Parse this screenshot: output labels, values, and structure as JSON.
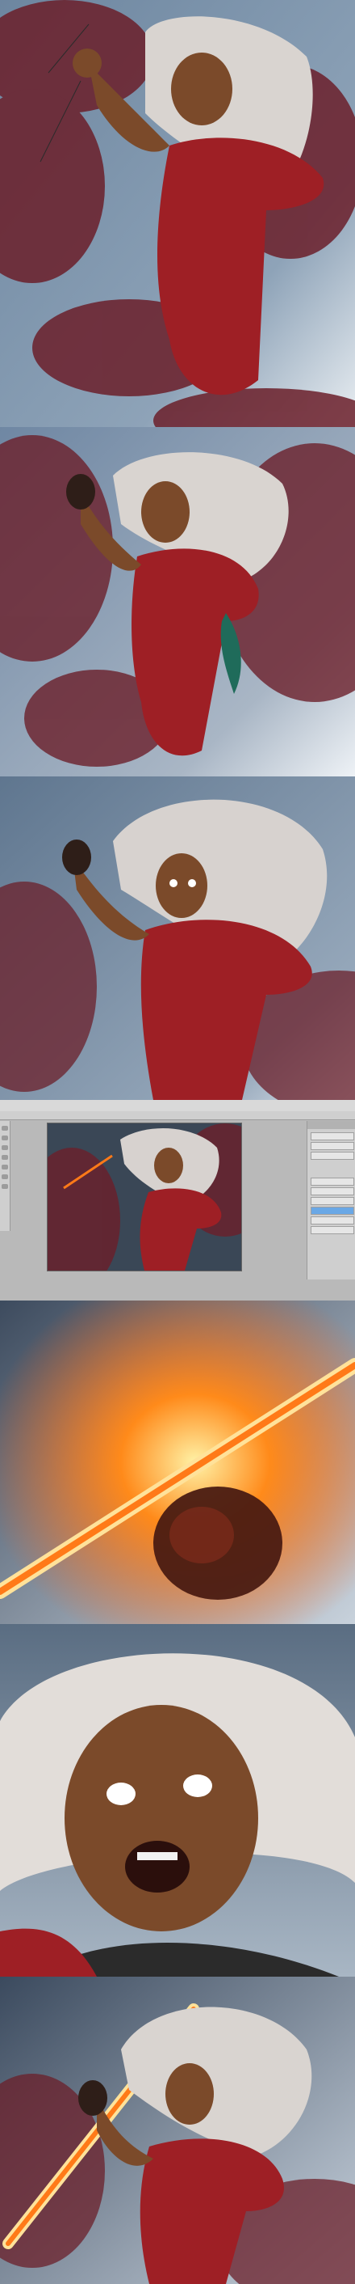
{
  "icons": {
    "toolbar_tools": [
      "move-tool-icon",
      "marquee-tool-icon",
      "lasso-tool-icon",
      "brush-tool-icon",
      "eraser-tool-icon",
      "eyedropper-tool-icon",
      "zoom-tool-icon"
    ]
  },
  "colors": {
    "sky": "#6f87a3",
    "smoke": "#6b1f2a",
    "hair": "#d9d4d0",
    "suit_red": "#9e1f25",
    "skin": "#7b4a2a",
    "fire": "#ff7a18"
  }
}
